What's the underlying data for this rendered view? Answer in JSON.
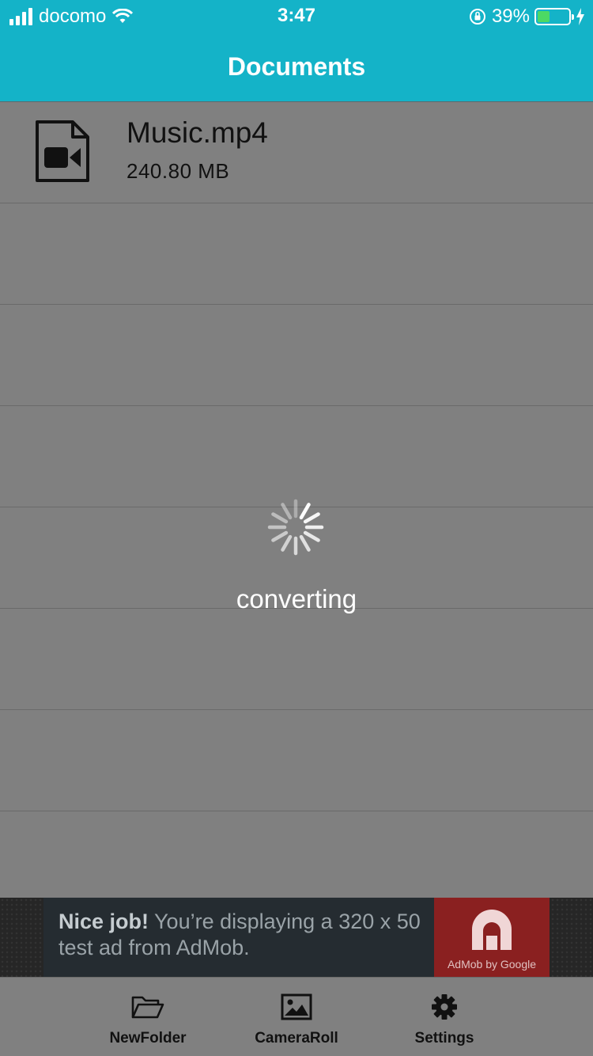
{
  "status_bar": {
    "carrier": "docomo",
    "time": "3:47",
    "battery_percent": "39%",
    "battery_level": 0.39
  },
  "nav": {
    "title": "Documents"
  },
  "files": [
    {
      "name": "Music.mp4",
      "size": "240.80 MB",
      "icon": "video-file-icon"
    }
  ],
  "overlay": {
    "status_text": "converting"
  },
  "ad": {
    "headline": "Nice job!",
    "body": " You’re displaying a 320 x 50 test ad from AdMob.",
    "brand": "AdMob by Google"
  },
  "tabs": [
    {
      "label": "NewFolder",
      "icon": "folder-open-icon"
    },
    {
      "label": "CameraRoll",
      "icon": "image-icon"
    },
    {
      "label": "Settings",
      "icon": "gear-icon"
    }
  ],
  "colors": {
    "accent": "#14b3c8",
    "overlay_dim": "#808080",
    "battery_fill": "#4cd964",
    "ad_logo_bg": "#8a2020"
  }
}
